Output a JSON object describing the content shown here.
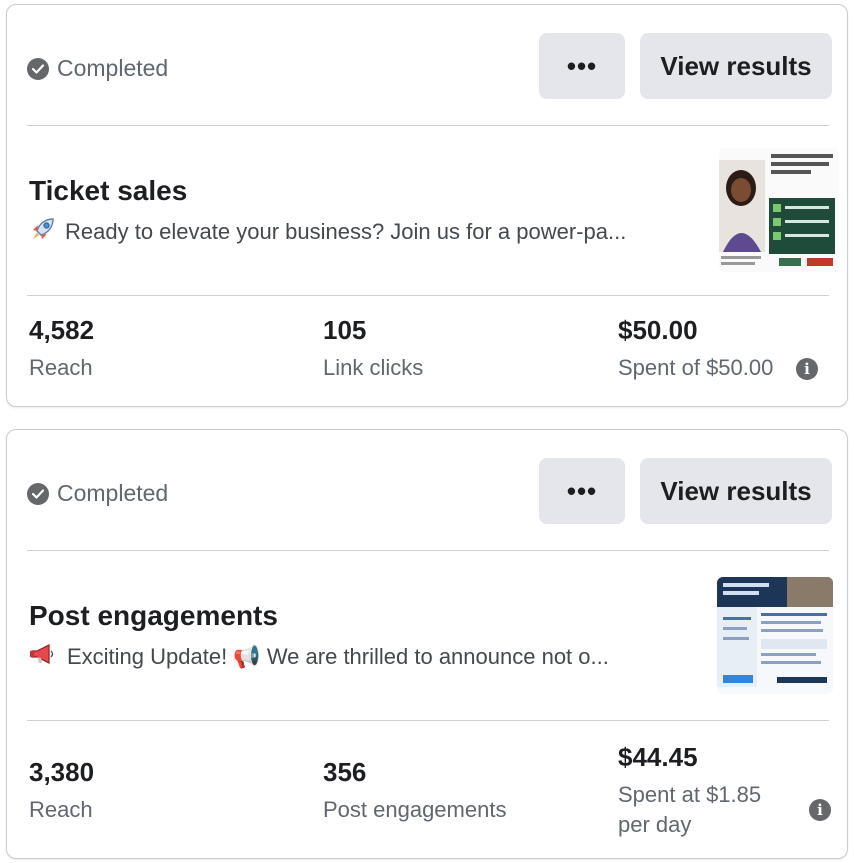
{
  "campaigns": [
    {
      "status": "Completed",
      "more_label": "•••",
      "view_results_label": "View results",
      "title": "Ticket sales",
      "description_icon": "rocket-icon",
      "description": "Ready to elevate your business? Join us for a power-pa...",
      "metrics": [
        {
          "value": "4,582",
          "label": "Reach"
        },
        {
          "value": "105",
          "label": "Link clicks"
        },
        {
          "value": "$50.00",
          "label": "Spent of $50.00"
        }
      ]
    },
    {
      "status": "Completed",
      "more_label": "•••",
      "view_results_label": "View results",
      "title": "Post engagements",
      "description_icon": "megaphone-icon",
      "description": "Exciting Update! 📢 We are thrilled to announce not o...",
      "metrics": [
        {
          "value": "3,380",
          "label": "Reach"
        },
        {
          "value": "356",
          "label": "Post engagements"
        },
        {
          "value": "$44.45",
          "label": "Spent at $1.85 per day"
        }
      ]
    }
  ],
  "colors": {
    "button_bg": "#e4e6eb",
    "status_gray": "#65676b",
    "divider": "#ced0d4",
    "card_border": "#c9ccd1"
  }
}
